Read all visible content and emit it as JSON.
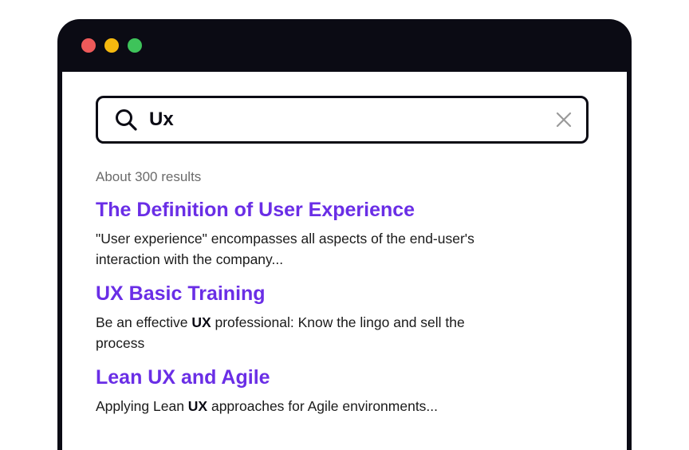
{
  "window": {
    "traffic_lights": {
      "close_color": "#ee5a5a",
      "minimize_color": "#f5b90f",
      "maximize_color": "#3ec35a"
    }
  },
  "search": {
    "value": "Ux",
    "icon": "search-icon",
    "clear_icon": "close-icon"
  },
  "results": {
    "count_text": "About 300 results",
    "items": [
      {
        "title": "The Definition of User Experience",
        "snippet_parts": [
          "\"User experience\" encompasses all aspects of the end-user's interaction with the company..."
        ]
      },
      {
        "title": "UX Basic Training",
        "snippet_parts": [
          "Be an effective ",
          "UX",
          " professional: Know the lingo and sell the process"
        ]
      },
      {
        "title": "Lean UX and Agile",
        "snippet_parts": [
          "Applying Lean ",
          "UX",
          " approaches for Agile environments..."
        ]
      }
    ]
  },
  "colors": {
    "link": "#6a2ee6",
    "frame": "#0b0b14",
    "muted": "#6b6b6b"
  }
}
